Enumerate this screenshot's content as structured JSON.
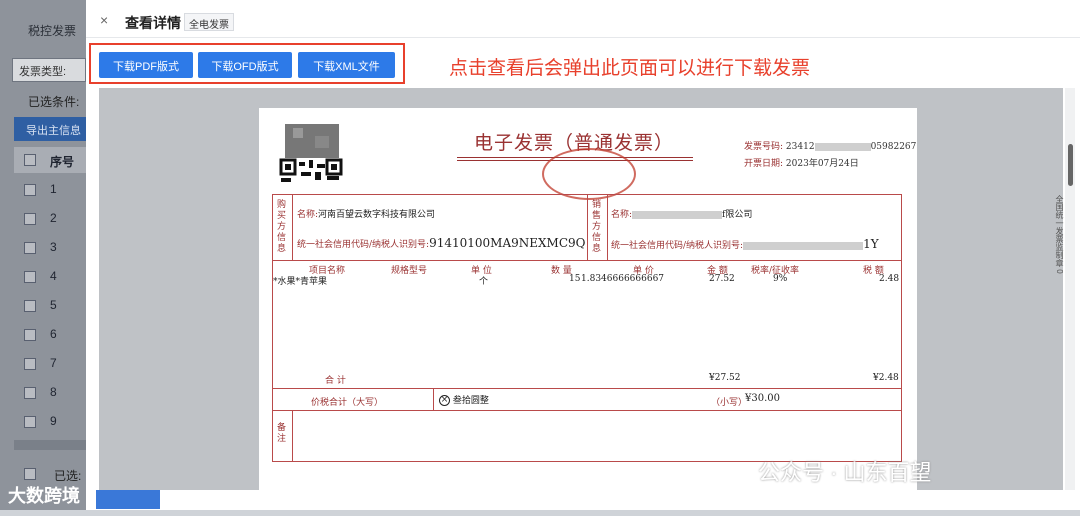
{
  "background": {
    "menu_title": "税控发票",
    "invoice_type_label": "发票类型:",
    "selected_conditions": "已选条件:",
    "export_button": "导出主信息",
    "seq_header": "序号",
    "rows": [
      "1",
      "2",
      "3",
      "4",
      "5",
      "6",
      "7",
      "8",
      "9"
    ],
    "selected_label": "已选:",
    "watermark": "大数跨境"
  },
  "panel": {
    "close_glyph": "×",
    "title": "查看详情",
    "tag": "全电发票",
    "buttons": {
      "pdf": "下载PDF版式",
      "ofd": "下载OFD版式",
      "xml": "下载XML文件"
    },
    "annotation": "点击查看后会弹出此页面可以进行下载发票",
    "side_text": "全国统一发票监制章 0"
  },
  "invoice": {
    "title": "电子发票（普通发票）",
    "number_label": "发票号码:",
    "number_prefix": "23412",
    "number_suffix": "05982267",
    "date_label": "开票日期:",
    "date": "2023年07月24日",
    "buyer_label": "购买方信息",
    "buyer_name_label": "名称:",
    "buyer_name": "河南百望云数字科技有限公司",
    "buyer_tax_label": "统一社会信用代码/纳税人识别号:",
    "buyer_tax_id": "91410100MA9NEXMC9Q",
    "seller_label": "销售方信息",
    "seller_name_label": "名称:",
    "seller_name_suffix": "f限公司",
    "seller_tax_label": "统一社会信用代码/纳税人识别号:",
    "seller_tax_suffix": "1Y",
    "table": {
      "headers": [
        "项目名称",
        "规格型号",
        "单 位",
        "数 量",
        "单 价",
        "金 额",
        "税率/征收率",
        "税 额"
      ],
      "item": {
        "name": "*水果*青苹果",
        "unit": "个",
        "qty": "15",
        "price": "1.8346666666667",
        "amount": "27.52",
        "rate": "9%",
        "tax": "2.48"
      }
    },
    "total_label": "合 计",
    "total_amount": "¥27.52",
    "total_tax": "¥2.48",
    "sum_label": "价税合计（大写）",
    "sum_upper": "叁拾圆整",
    "sum_small_label": "（小写）",
    "sum_small": "¥30.00",
    "remark_label": "备注"
  },
  "wechat_watermark": "公众号 · 山东百望"
}
